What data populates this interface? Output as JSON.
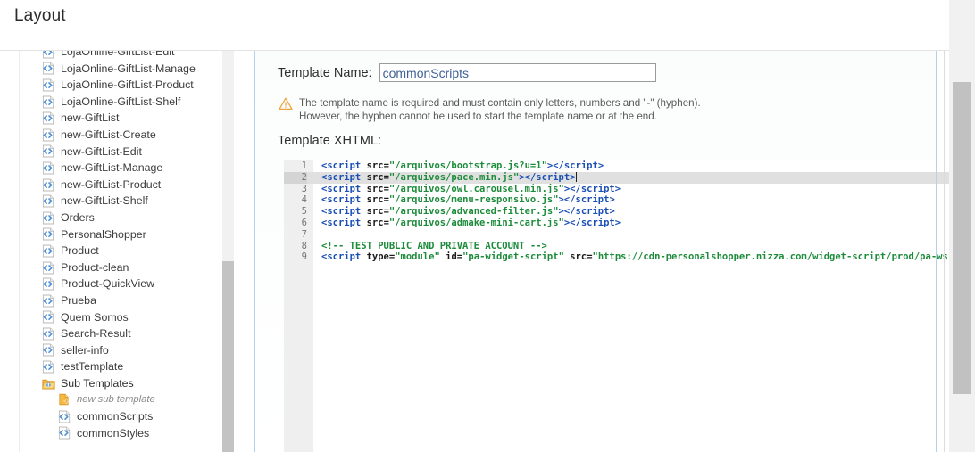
{
  "header": {
    "title": "Layout"
  },
  "sidebar": {
    "items": [
      {
        "label": "LojaOnline-GiftList-Edit",
        "icon": "xhtml-file-icon",
        "indent": 0,
        "clipped": true
      },
      {
        "label": "LojaOnline-GiftList-Manage",
        "icon": "xhtml-file-icon",
        "indent": 0
      },
      {
        "label": "LojaOnline-GiftList-Product",
        "icon": "xhtml-file-icon",
        "indent": 0
      },
      {
        "label": "LojaOnline-GiftList-Shelf",
        "icon": "xhtml-file-icon",
        "indent": 0
      },
      {
        "label": "new-GiftList",
        "icon": "xhtml-file-icon",
        "indent": 0
      },
      {
        "label": "new-GiftList-Create",
        "icon": "xhtml-file-icon",
        "indent": 0
      },
      {
        "label": "new-GiftList-Edit",
        "icon": "xhtml-file-icon",
        "indent": 0
      },
      {
        "label": "new-GiftList-Manage",
        "icon": "xhtml-file-icon",
        "indent": 0
      },
      {
        "label": "new-GiftList-Product",
        "icon": "xhtml-file-icon",
        "indent": 0
      },
      {
        "label": "new-GiftList-Shelf",
        "icon": "xhtml-file-icon",
        "indent": 0
      },
      {
        "label": "Orders",
        "icon": "xhtml-file-icon",
        "indent": 0
      },
      {
        "label": "PersonalShopper",
        "icon": "xhtml-file-icon",
        "indent": 0
      },
      {
        "label": "Product",
        "icon": "xhtml-file-icon",
        "indent": 0
      },
      {
        "label": "Product-clean",
        "icon": "xhtml-file-icon",
        "indent": 0
      },
      {
        "label": "Product-QuickView",
        "icon": "xhtml-file-icon",
        "indent": 0
      },
      {
        "label": "Prueba",
        "icon": "xhtml-file-icon",
        "indent": 0
      },
      {
        "label": "Quem Somos",
        "icon": "xhtml-file-icon",
        "indent": 0
      },
      {
        "label": "Search-Result",
        "icon": "xhtml-file-icon",
        "indent": 0
      },
      {
        "label": "seller-info",
        "icon": "xhtml-file-icon",
        "indent": 0
      },
      {
        "label": "testTemplate",
        "icon": "xhtml-file-icon",
        "indent": 0
      },
      {
        "label": "Sub Templates",
        "icon": "folder-icon",
        "indent": 0
      },
      {
        "label": "new sub template",
        "icon": "new-file-icon",
        "indent": 1,
        "italic": true
      },
      {
        "label": "commonScripts",
        "icon": "xhtml-file-icon",
        "indent": 1
      },
      {
        "label": "commonStyles",
        "icon": "xhtml-file-icon",
        "indent": 1
      }
    ]
  },
  "form": {
    "name_label": "Template Name:",
    "name_value": "commonScripts",
    "name_placeholder": "Template Name",
    "warning_line1": "The template name is required and must contain only letters, numbers and \"-\" (hyphen).",
    "warning_line2": "However, the hyphen cannot be used to start the template name or at the end.",
    "xhtml_label": "Template XHTML:"
  },
  "editor": {
    "active_line": 2,
    "lines": [
      {
        "n": "1",
        "tokens": [
          {
            "t": "&lt;",
            "c": "tok-tag"
          },
          {
            "t": "script",
            "c": "tok-tag"
          },
          {
            "t": " ",
            "c": "tok-plain"
          },
          {
            "t": "src",
            "c": "tok-attr"
          },
          {
            "t": "=",
            "c": "tok-plain"
          },
          {
            "t": "\"/arquivos/bootstrap.js?u=1\"",
            "c": "tok-str"
          },
          {
            "t": "&gt;&lt;/",
            "c": "tok-tag"
          },
          {
            "t": "script",
            "c": "tok-tag"
          },
          {
            "t": "&gt;",
            "c": "tok-tag"
          }
        ]
      },
      {
        "n": "2",
        "tokens": [
          {
            "t": "&lt;",
            "c": "tok-tag"
          },
          {
            "t": "script",
            "c": "tok-tag"
          },
          {
            "t": " ",
            "c": "tok-plain"
          },
          {
            "t": "src",
            "c": "tok-attr"
          },
          {
            "t": "=",
            "c": "tok-plain"
          },
          {
            "t": "\"/arquivos/pace.min.js\"",
            "c": "tok-str"
          },
          {
            "t": "&gt;&lt;/",
            "c": "tok-tag"
          },
          {
            "t": "script",
            "c": "tok-tag"
          },
          {
            "t": "&gt;",
            "c": "tok-tag"
          }
        ]
      },
      {
        "n": "3",
        "tokens": [
          {
            "t": "&lt;",
            "c": "tok-tag"
          },
          {
            "t": "script",
            "c": "tok-tag"
          },
          {
            "t": " ",
            "c": "tok-plain"
          },
          {
            "t": "src",
            "c": "tok-attr"
          },
          {
            "t": "=",
            "c": "tok-plain"
          },
          {
            "t": "\"/arquivos/owl.carousel.min.js\"",
            "c": "tok-str"
          },
          {
            "t": "&gt;&lt;/",
            "c": "tok-tag"
          },
          {
            "t": "script",
            "c": "tok-tag"
          },
          {
            "t": "&gt;",
            "c": "tok-tag"
          }
        ]
      },
      {
        "n": "4",
        "tokens": [
          {
            "t": "&lt;",
            "c": "tok-tag"
          },
          {
            "t": "script",
            "c": "tok-tag"
          },
          {
            "t": " ",
            "c": "tok-plain"
          },
          {
            "t": "src",
            "c": "tok-attr"
          },
          {
            "t": "=",
            "c": "tok-plain"
          },
          {
            "t": "\"/arquivos/menu-responsivo.js\"",
            "c": "tok-str"
          },
          {
            "t": "&gt;&lt;/",
            "c": "tok-tag"
          },
          {
            "t": "script",
            "c": "tok-tag"
          },
          {
            "t": "&gt;",
            "c": "tok-tag"
          }
        ]
      },
      {
        "n": "5",
        "tokens": [
          {
            "t": "&lt;",
            "c": "tok-tag"
          },
          {
            "t": "script",
            "c": "tok-tag"
          },
          {
            "t": " ",
            "c": "tok-plain"
          },
          {
            "t": "src",
            "c": "tok-attr"
          },
          {
            "t": "=",
            "c": "tok-plain"
          },
          {
            "t": "\"/arquivos/advanced-filter.js\"",
            "c": "tok-str"
          },
          {
            "t": "&gt;&lt;/",
            "c": "tok-tag"
          },
          {
            "t": "script",
            "c": "tok-tag"
          },
          {
            "t": "&gt;",
            "c": "tok-tag"
          }
        ]
      },
      {
        "n": "6",
        "tokens": [
          {
            "t": "&lt;",
            "c": "tok-tag"
          },
          {
            "t": "script",
            "c": "tok-tag"
          },
          {
            "t": " ",
            "c": "tok-plain"
          },
          {
            "t": "src",
            "c": "tok-attr"
          },
          {
            "t": "=",
            "c": "tok-plain"
          },
          {
            "t": "\"/arquivos/admake-mini-cart.js\"",
            "c": "tok-str"
          },
          {
            "t": "&gt;&lt;/",
            "c": "tok-tag"
          },
          {
            "t": "script",
            "c": "tok-tag"
          },
          {
            "t": "&gt;",
            "c": "tok-tag"
          }
        ]
      },
      {
        "n": "7",
        "tokens": []
      },
      {
        "n": "8",
        "tokens": [
          {
            "t": "&lt;!-- TEST PUBLIC AND PRIVATE ACCOUNT --&gt;",
            "c": "tok-cmt"
          }
        ]
      },
      {
        "n": "9",
        "tokens": [
          {
            "t": "&lt;",
            "c": "tok-tag"
          },
          {
            "t": "script",
            "c": "tok-tag"
          },
          {
            "t": " ",
            "c": "tok-plain"
          },
          {
            "t": "type",
            "c": "tok-attr"
          },
          {
            "t": "=",
            "c": "tok-plain"
          },
          {
            "t": "\"module\"",
            "c": "tok-str"
          },
          {
            "t": " ",
            "c": "tok-plain"
          },
          {
            "t": "id",
            "c": "tok-attr"
          },
          {
            "t": "=",
            "c": "tok-plain"
          },
          {
            "t": "\"pa-widget-script\"",
            "c": "tok-str"
          },
          {
            "t": " ",
            "c": "tok-plain"
          },
          {
            "t": "src",
            "c": "tok-attr"
          },
          {
            "t": "=",
            "c": "tok-plain"
          },
          {
            "t": "\"https://cdn-personalshopper.nizza.com/widget-script/prod/pa-ws-index",
            "c": "tok-str"
          }
        ]
      }
    ]
  },
  "colors": {
    "accent_blue": "#4a90d9",
    "warning_orange": "#f0a33c",
    "code_tag": "#1a4fb4",
    "code_string": "#1c8b3a",
    "input_text": "#3f6196",
    "scrollbar_thumb": "#c1c1c1",
    "active_line": "#e0e0e0"
  }
}
